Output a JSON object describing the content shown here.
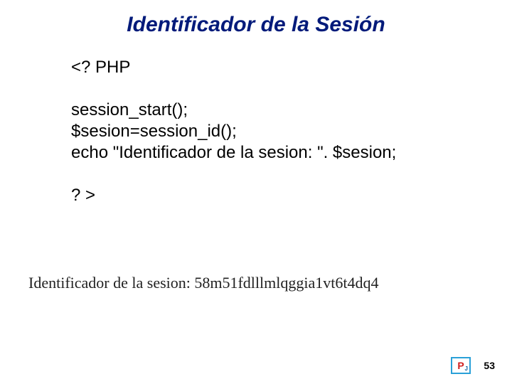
{
  "title": "Identificador de la Sesión",
  "code": {
    "open_tag": "<? PHP",
    "line1": "session_start();",
    "line2": "$sesion=session_id();",
    "line3": "echo \"Identificador de la sesion: \". $sesion;",
    "close_tag": "? >"
  },
  "output": "Identificador de la sesion: 58m51fdlllmlqggia1vt6t4dq4",
  "page_number": "53",
  "logo_text": "P"
}
